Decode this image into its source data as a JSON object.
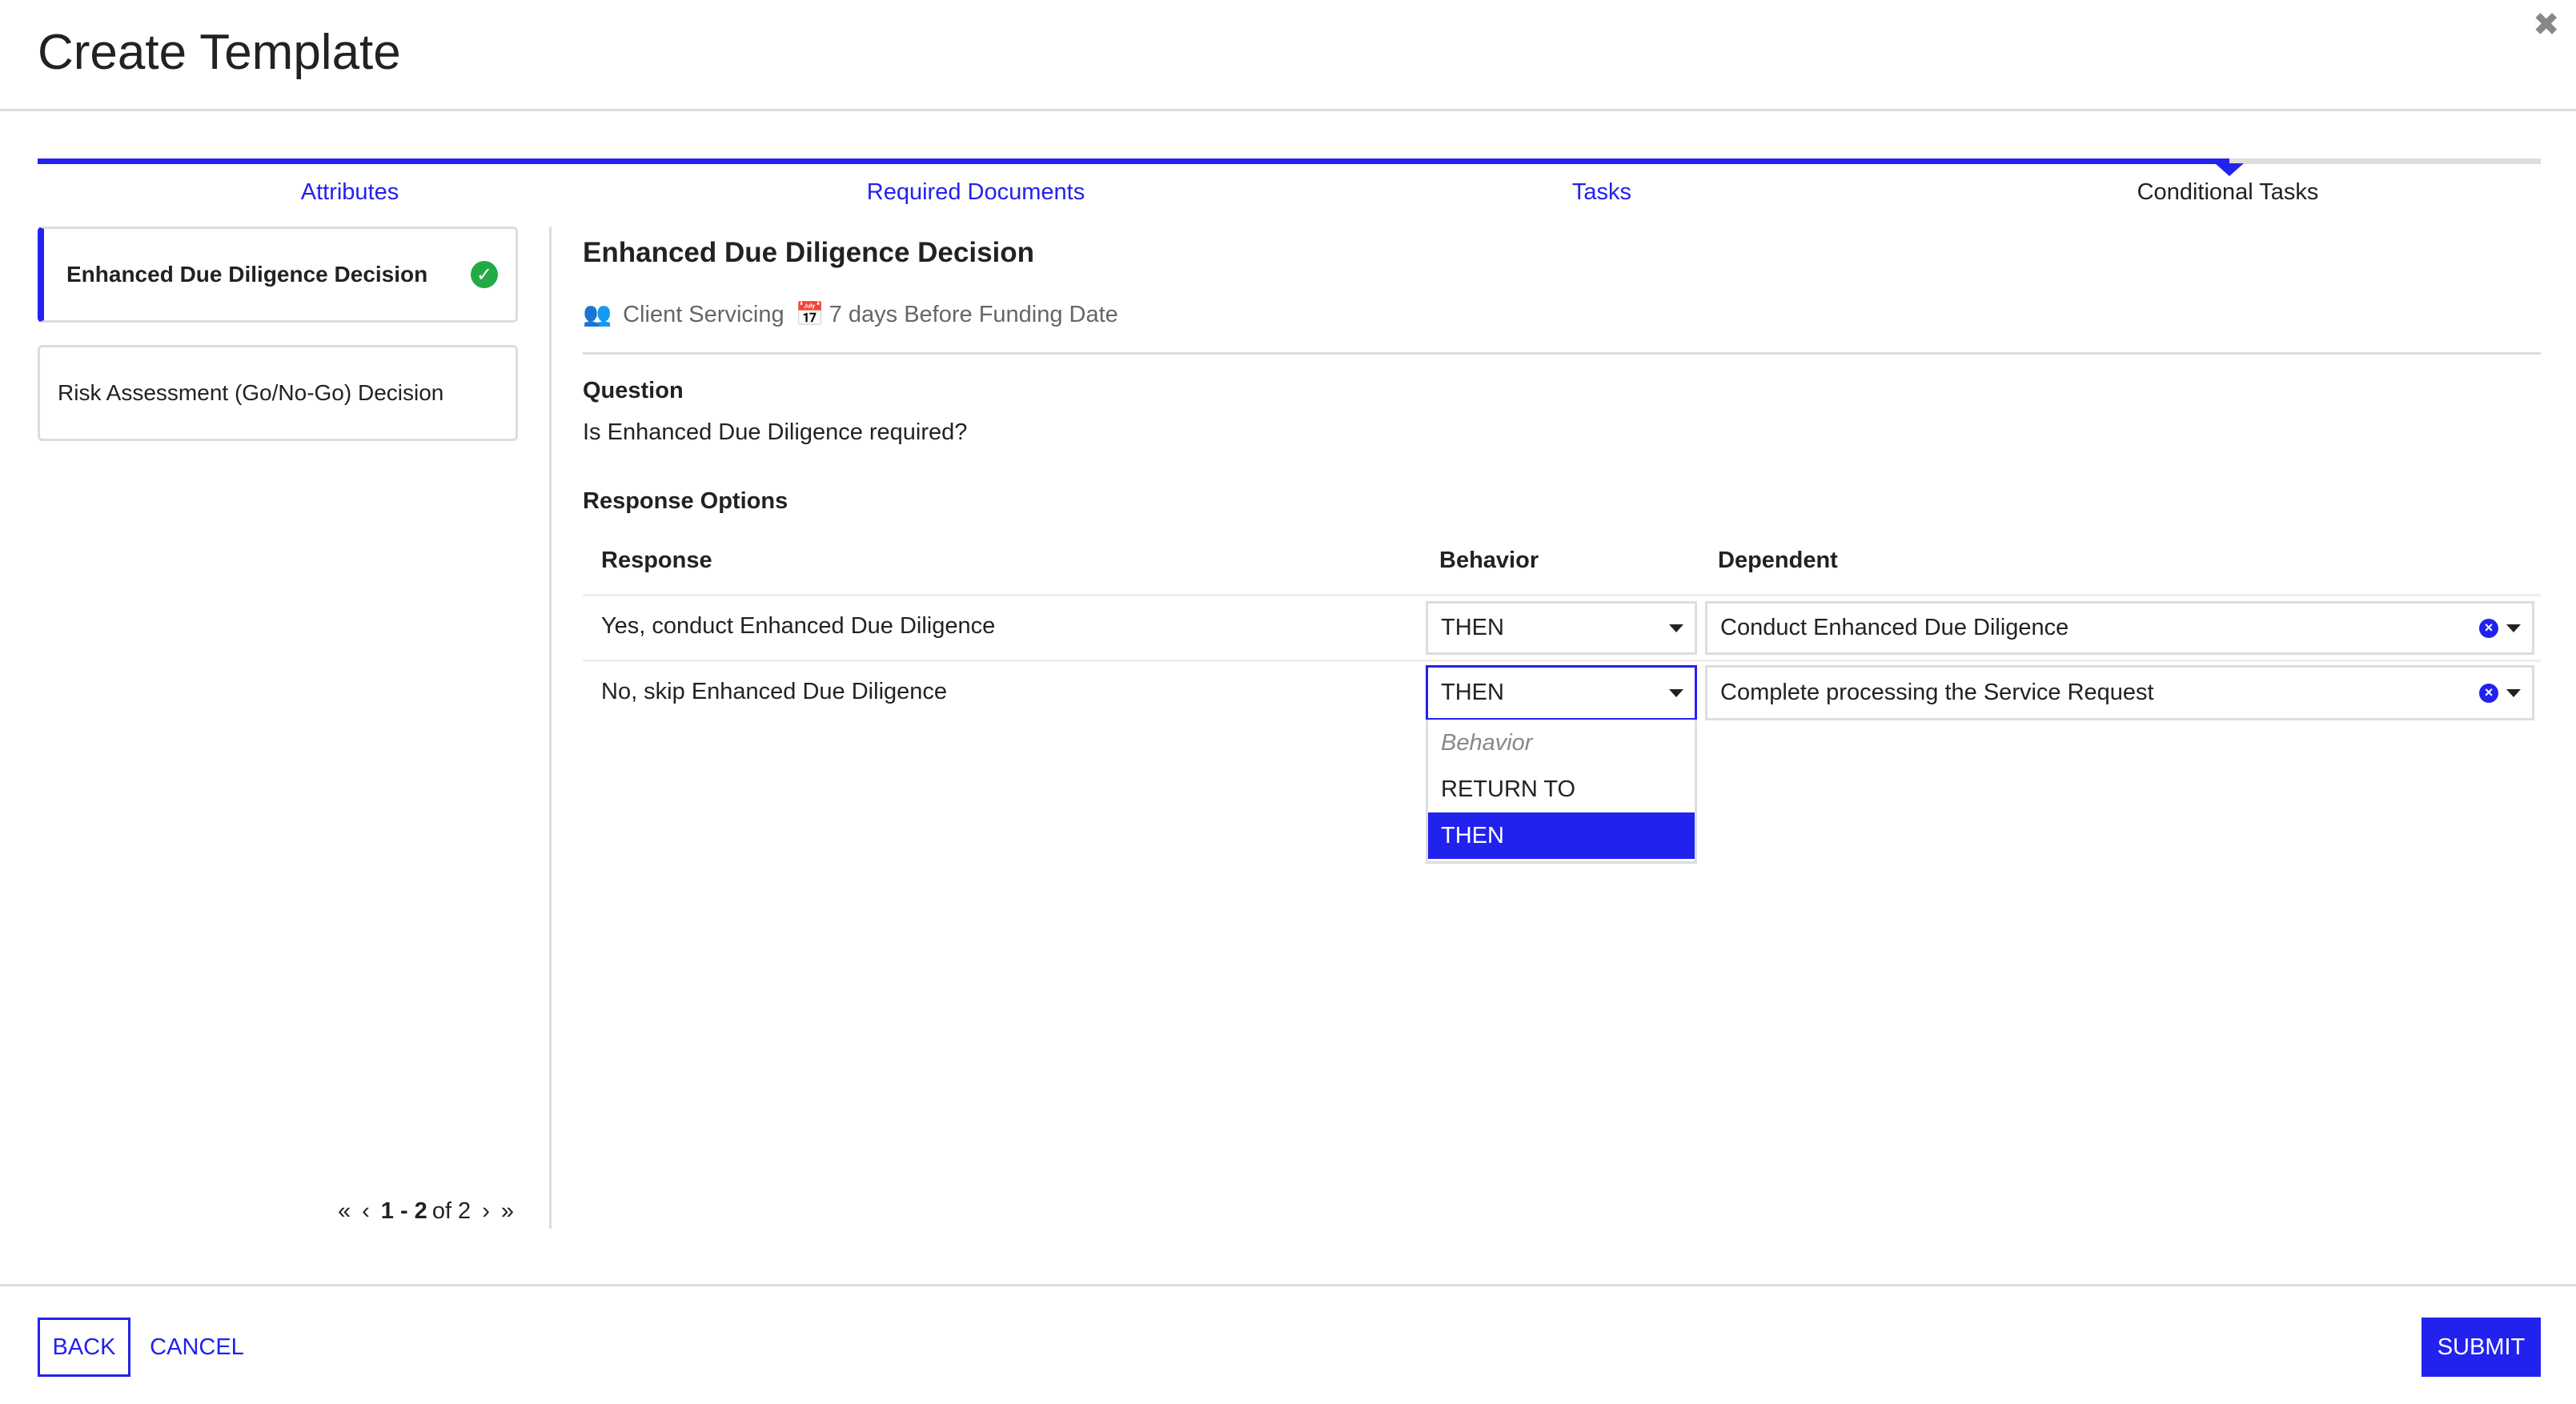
{
  "header": {
    "title": "Create Template",
    "close_icon": "close-icon"
  },
  "colors": {
    "accent": "#2222ee",
    "success": "#22aa44"
  },
  "progress": {
    "current_step": 4,
    "total_steps": 4
  },
  "steps": [
    {
      "label": "Attributes",
      "state": "link"
    },
    {
      "label": "Required Documents",
      "state": "link"
    },
    {
      "label": "Tasks",
      "state": "link"
    },
    {
      "label": "Conditional Tasks",
      "state": "current"
    }
  ],
  "sidebar": {
    "items": [
      {
        "label": "Enhanced Due Diligence Decision",
        "selected": true,
        "complete": true
      },
      {
        "label": "Risk Assessment (Go/No-Go) Decision",
        "selected": false
      }
    ],
    "pager": {
      "first": "«",
      "prev": "‹",
      "range": "1 - 2",
      "of": "of 2",
      "next": "›",
      "last": "»"
    }
  },
  "task": {
    "title": "Enhanced Due Diligence Decision",
    "team": "Client Servicing",
    "due": "7 days Before Funding Date",
    "question_label": "Question",
    "question": "Is Enhanced Due Diligence required?",
    "options_label": "Response Options",
    "columns": [
      "Response",
      "Behavior",
      "Dependent"
    ],
    "rows": [
      {
        "response": "Yes, conduct Enhanced Due Diligence",
        "behavior": "THEN",
        "dependent": "Conduct Enhanced Due Diligence"
      },
      {
        "response": "No, skip Enhanced Due Diligence",
        "behavior": "THEN",
        "dependent": "Complete processing the Service Request"
      }
    ],
    "behavior_dropdown": {
      "placeholder": "Behavior",
      "options": [
        "RETURN TO",
        "THEN"
      ],
      "highlighted": "THEN"
    }
  },
  "footer": {
    "back": "BACK",
    "cancel": "CANCEL",
    "submit": "SUBMIT"
  }
}
